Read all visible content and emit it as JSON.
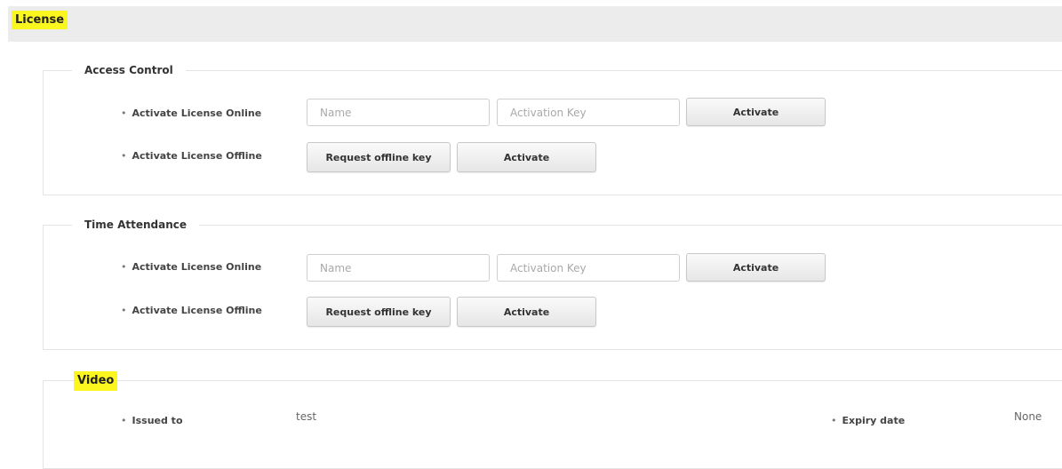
{
  "page": {
    "title": "License"
  },
  "access_control": {
    "legend": "Access Control",
    "online": {
      "label": "Activate License Online",
      "name_placeholder": "Name",
      "key_placeholder": "Activation Key",
      "activate_label": "Activate"
    },
    "offline": {
      "label": "Activate License Offline",
      "request_label": "Request offline key",
      "activate_label": "Activate"
    }
  },
  "time_attendance": {
    "legend": "Time Attendance",
    "online": {
      "label": "Activate License Online",
      "name_placeholder": "Name",
      "key_placeholder": "Activation Key",
      "activate_label": "Activate"
    },
    "offline": {
      "label": "Activate License Offline",
      "request_label": "Request offline key",
      "activate_label": "Activate"
    }
  },
  "video": {
    "legend": "Video",
    "issued_to_label": "Issued to",
    "issued_to_value": "test",
    "expiry_label": "Expiry date",
    "expiry_value": "None"
  },
  "colors": {
    "highlight": "#fbf61e",
    "header_bg": "#ececec"
  }
}
